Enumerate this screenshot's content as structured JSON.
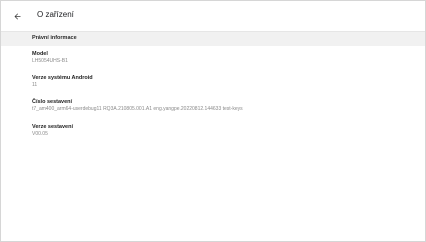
{
  "header": {
    "title": "O zařízení"
  },
  "section": {
    "label": "Právní informace"
  },
  "items": [
    {
      "label": "Model",
      "value": "LH5054UHS-B1"
    },
    {
      "label": "Verze systému Android",
      "value": "11"
    },
    {
      "label": "Číslo sestavení",
      "value": "t7_am400_arm64-userdebug11 RQ3A.210805.001.A1 eng.yangpe.20220812.144633 test-keys"
    },
    {
      "label": "Verze sestavení",
      "value": "V00.05"
    }
  ]
}
